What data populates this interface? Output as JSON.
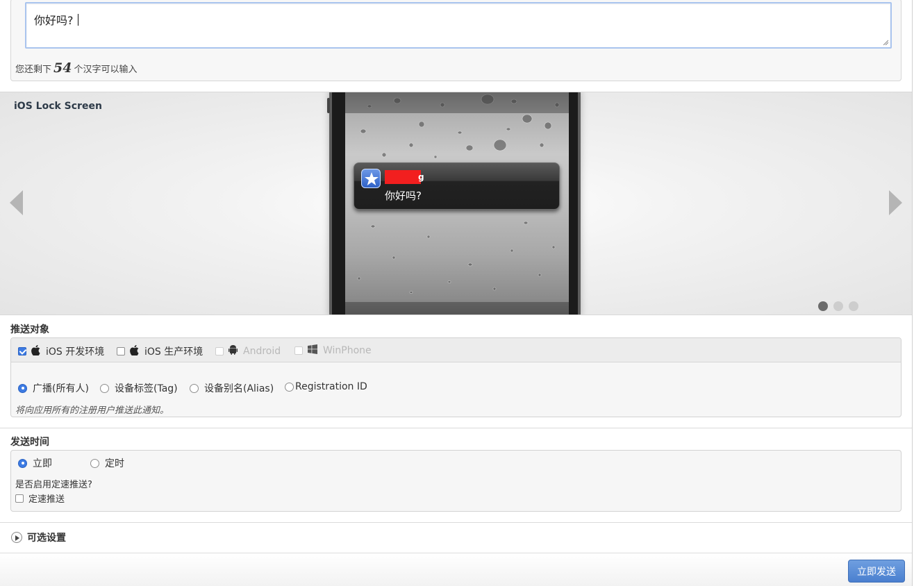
{
  "message": {
    "text": "你好吗?",
    "remaining_prefix": "您还剩下",
    "remaining_count": "54",
    "remaining_suffix": "个汉字可以输入"
  },
  "preview": {
    "title": "iOS Lock Screen",
    "notification_app_tail": "g",
    "notification_text": "你好吗?",
    "slide_count": 3,
    "active_slide": 1
  },
  "target": {
    "label": "推送对象",
    "platforms": [
      {
        "label": "iOS 开发环境",
        "icon": "apple-icon",
        "checked": true,
        "enabled": true
      },
      {
        "label": "iOS 生产环境",
        "icon": "apple-icon",
        "checked": false,
        "enabled": true
      },
      {
        "label": "Android",
        "icon": "android-icon",
        "checked": false,
        "enabled": false
      },
      {
        "label": "WinPhone",
        "icon": "windows-icon",
        "checked": false,
        "enabled": false
      }
    ],
    "audience": [
      {
        "label": "广播(所有人)",
        "checked": true
      },
      {
        "label": "设备标签(Tag)",
        "checked": false
      },
      {
        "label": "设备别名(Alias)",
        "checked": false
      },
      {
        "label": "Registration ID",
        "checked": false
      }
    ],
    "hint": "将向应用所有的注册用户推送此通知。"
  },
  "send_time": {
    "label": "发送时间",
    "options": [
      {
        "label": "立即",
        "checked": true
      },
      {
        "label": "定时",
        "checked": false
      }
    ],
    "rate_question": "是否启用定速推送?",
    "rate_label": "定速推送",
    "rate_checked": false
  },
  "optional": {
    "label": "可选设置"
  },
  "footer": {
    "send_label": "立即发送"
  },
  "colors": {
    "accent": "#3d7be3",
    "send_button": "#4a7fcf",
    "notif_redaction": "#f21f1f"
  }
}
